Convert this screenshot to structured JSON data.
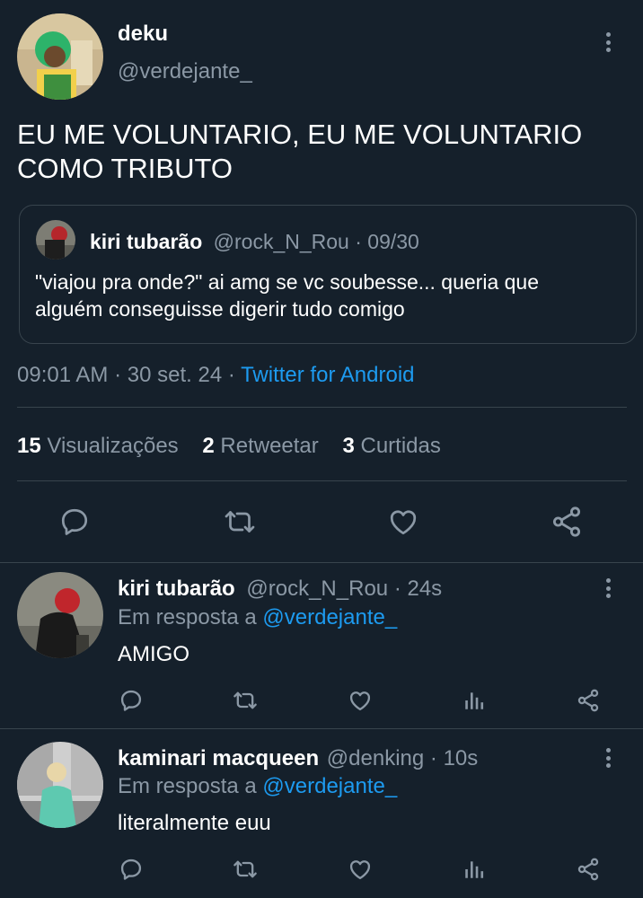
{
  "tweet": {
    "author_name": "deku",
    "author_handle": "@verdejante_",
    "text_line1": "EU ME VOLUNTARIO, EU ME VOLUNTARIO",
    "text_line2": "COMO TRIBUTO",
    "time": "09:01 AM",
    "date": "30 set. 24",
    "source": "Twitter for Android",
    "separator": "·"
  },
  "quote": {
    "author_name": "kiri tubarão",
    "author_handle": "@rock_N_Rou",
    "date": "09/30",
    "text_line1": "\"viajou pra onde?\" ai amg se vc soubesse... queria que",
    "text_line2": "alguém conseguisse digerir tudo comigo"
  },
  "stats": {
    "views_count": "15",
    "views_label": "Visualizações",
    "retweets_count": "2",
    "retweets_label": "Retweetar",
    "likes_count": "3",
    "likes_label": "Curtidas"
  },
  "replies": [
    {
      "author_name": "kiri tubarão",
      "author_handle": "@rock_N_Rou",
      "time": "24s",
      "reply_prefix": "Em resposta a",
      "reply_to": "@verdejante_",
      "text": "AMIGO"
    },
    {
      "author_name": "kaminari macqueen",
      "author_handle": "@denking",
      "time": "10s",
      "reply_prefix": "Em resposta a",
      "reply_to": "@verdejante_",
      "text": "literalmente euu"
    }
  ],
  "icons": {
    "reply": "reply-icon",
    "retweet": "retweet-icon",
    "like": "like-icon",
    "share": "share-icon",
    "views": "views-icon",
    "more": "more-options-icon"
  },
  "colors": {
    "background": "#15202b",
    "link": "#1d9bf0",
    "muted": "#8b98a5",
    "divider": "#38444d"
  }
}
